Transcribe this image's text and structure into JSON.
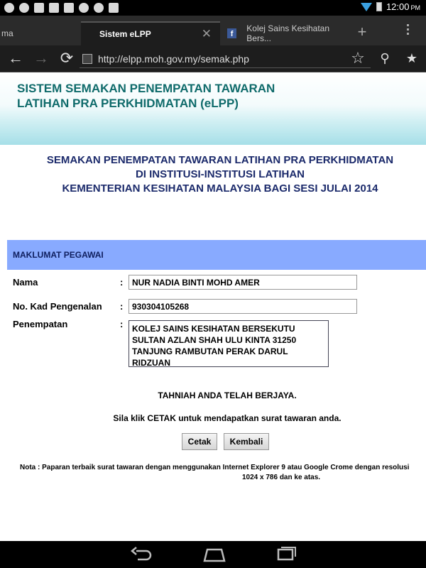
{
  "status_bar": {
    "time": "12:00",
    "ampm": "PM",
    "icons": [
      "notification-icon",
      "notification-icon",
      "image-icon",
      "instagram-icon",
      "cleaner-icon",
      "browser-icon",
      "facebook-icon"
    ]
  },
  "tabs": [
    {
      "label": "ma"
    },
    {
      "label": "Sistem eLPP"
    },
    {
      "label": "Kolej Sains Kesihatan Bers..."
    }
  ],
  "omnibox": {
    "url": "http://elpp.moh.gov.my/semak.php"
  },
  "page": {
    "banner_title_line1": "SISTEM SEMAKAN PENEMPATAN TAWARAN",
    "banner_title_line2": "LATIHAN PRA PERKHIDMATAN (eLPP)",
    "heading_line1": "SEMAKAN PENEMPATAN TAWARAN LATIHAN PRA PERKHIDMATAN",
    "heading_line2": "DI INSTITUSI-INSTITUSI LATIHAN",
    "heading_line3": "KEMENTERIAN KESIHATAN MALAYSIA BAGI SESI JULAI 2014",
    "section_title": "MAKLUMAT PEGAWAI",
    "fields": {
      "nama_label": "Nama",
      "nama_value": "NUR NADIA BINTI MOHD AMER",
      "kp_label": "No. Kad Pengenalan",
      "kp_value": "930304105268",
      "penempatan_label": "Penempatan",
      "penempatan_value": "KOLEJ SAINS KESIHATAN BERSEKUTU SULTAN AZLAN SHAH ULU KINTA 31250 TANJUNG RAMBUTAN PERAK DARUL RIDZUAN",
      "colon": ":"
    },
    "congrats": "TAHNIAH ANDA TELAH BERJAYA.",
    "instruction": "Sila klik CETAK untuk mendapatkan surat tawaran anda.",
    "buttons": {
      "cetak": "Cetak",
      "kembali": "Kembali"
    },
    "note_line1": "Nota : Paparan terbaik surat tawaran dengan menggunakan Internet Explorer 9 atau Google Crome dengan resolusi",
    "note_line2": "1024 x 786 dan ke atas."
  }
}
